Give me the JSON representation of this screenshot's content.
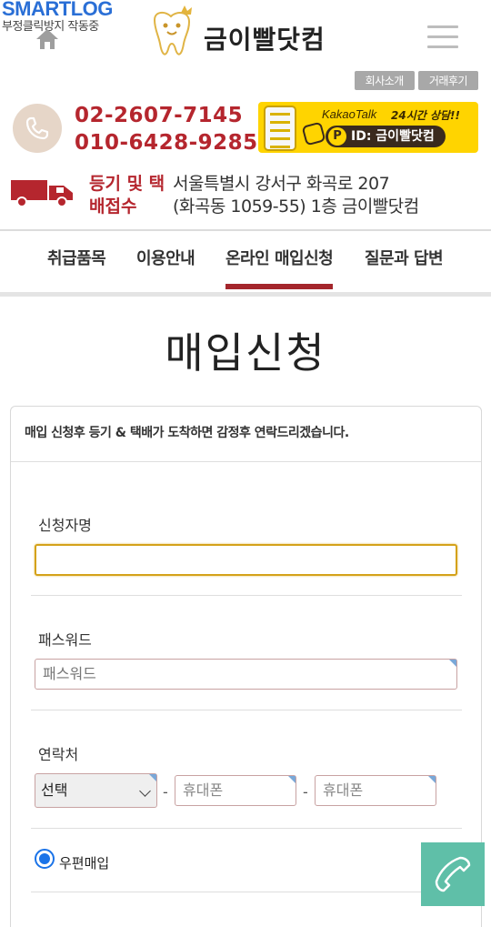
{
  "header": {
    "smartlog_brand": "SMARTLOG",
    "smartlog_sub": "부정클릭방지 작동중",
    "logo_name": "금이빨닷컴",
    "mini_buttons": [
      "회사소개",
      "거래후기"
    ]
  },
  "contact": {
    "phone1": "02-2607-7145",
    "phone2": "010-6428-9285",
    "kakao_label": "KakaoTalk",
    "kakao_hours": "24시간 상담!!",
    "kakao_id": "ID: 금이빨닷컴",
    "kakao_p": "P"
  },
  "delivery": {
    "label_line1": "등기 및 택",
    "label_line2": "배접수",
    "address_line1": "서울특별시 강서구 화곡로 207",
    "address_line2": "(화곡동 1059-55) 1층 금이빨닷컴"
  },
  "nav": {
    "items": [
      "취급품목",
      "이용안내",
      "온라인 매입신청",
      "질문과 답변"
    ],
    "active_index": 2
  },
  "page": {
    "title": "매입신청"
  },
  "form": {
    "notice": "매입 신청후 등기 & 택배가 도착하면 감정후 연락드리겠습니다.",
    "applicant_label": "신청자명",
    "applicant_value": "",
    "password_label": "패스워드",
    "password_placeholder": "패스워드",
    "contact_label": "연락처",
    "contact_select_value": "선택",
    "contact_sep": "-",
    "mobile_placeholder_1": "휴대폰",
    "mobile_placeholder_2": "휴대폰",
    "radio_label": "우편매입"
  },
  "colors": {
    "accent_red": "#b5262e",
    "nav_active": "#a4262c",
    "kakao_yellow": "#ffd400",
    "fab_green": "#5fbfa8",
    "focus_border": "#d4a21a"
  }
}
